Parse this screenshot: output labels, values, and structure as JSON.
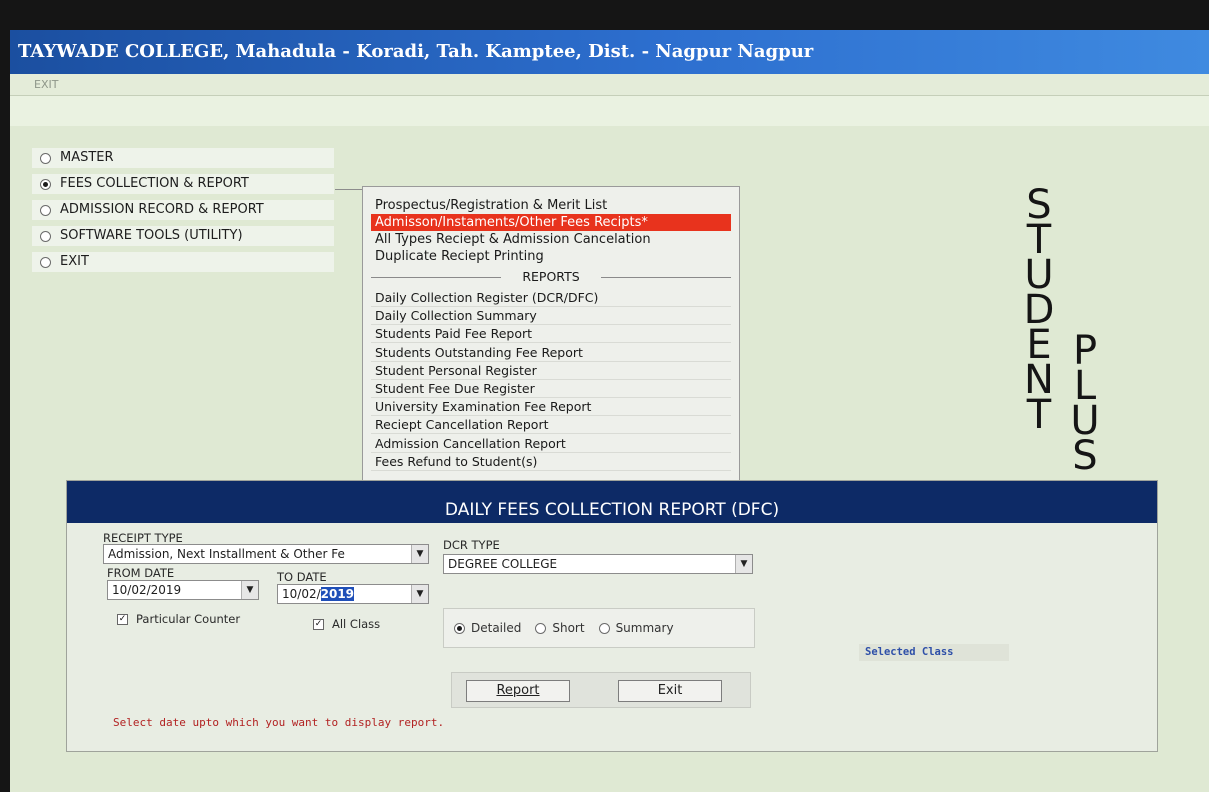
{
  "window": {
    "title": "TAYWADE COLLEGE, Mahadula - Koradi, Tah. Kamptee, Dist. - Nagpur Nagpur"
  },
  "menubar": {
    "exit": "EXIT"
  },
  "main_menu": {
    "items": [
      {
        "label": "MASTER",
        "selected": false
      },
      {
        "label": "FEES COLLECTION & REPORT",
        "selected": true
      },
      {
        "label": "ADMISSION RECORD & REPORT",
        "selected": false
      },
      {
        "label": "SOFTWARE TOOLS (UTILITY)",
        "selected": false
      },
      {
        "label": "EXIT",
        "selected": false
      }
    ]
  },
  "submenu": {
    "items": [
      "Prospectus/Registration & Merit List",
      "Admisson/Instaments/Other Fees Recipts*",
      "All Types Reciept & Admission Cancelation",
      "Duplicate Reciept Printing"
    ],
    "selected_index": 1,
    "reports_header": "REPORTS",
    "reports": [
      "Daily Collection Register (DCR/DFC)",
      "Daily Collection Summary",
      "Students Paid Fee Report",
      "Students Outstanding Fee Report",
      "Student Personal Register",
      "Student Fee Due Register",
      "University Examination Fee Report",
      "Reciept Cancellation Report",
      "Admission Cancellation Report",
      "Fees Refund to Student(s)"
    ]
  },
  "brand": {
    "word1": [
      "S",
      "T",
      "U",
      "D",
      "E",
      "N",
      "T"
    ],
    "word2": [
      "P",
      "L",
      "U",
      "S"
    ]
  },
  "report_panel": {
    "title": "DAILY FEES COLLECTION REPORT (DFC)",
    "receipt_type_label": "RECEIPT TYPE",
    "receipt_type_value": "Admission, Next Installment & Other Fe",
    "dcr_type_label": "DCR TYPE",
    "dcr_type_value": "DEGREE COLLEGE",
    "from_date_label": "FROM DATE",
    "from_date_value": "10/02/2019",
    "to_date_label": "TO DATE",
    "to_date_prefix": "10/02/",
    "to_date_year": "2019",
    "particular_counter": "Particular Counter",
    "all_class": "All Class",
    "options": [
      "Detailed",
      "Short",
      "Summary"
    ],
    "selected_option": "Detailed",
    "selected_class_label": "Selected Class",
    "report_button": "Report",
    "exit_button": "Exit",
    "status": "Select date upto which you want to display report."
  },
  "colors": {
    "titlebar": "#1b4fa0",
    "background": "#dfe9d3",
    "report_header": "#0d2a66",
    "selection": "#e8331d"
  }
}
